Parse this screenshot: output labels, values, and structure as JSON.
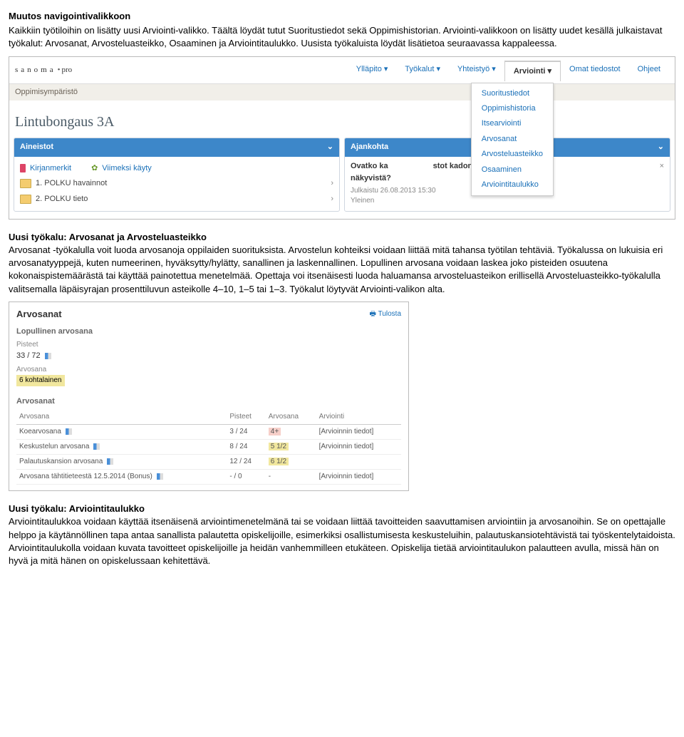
{
  "doc": {
    "h1": "Muutos navigointivalikkoon",
    "p1": "Kaikkiin työtiloihin on lisätty uusi Arviointi-valikko. Täältä löydät tutut Suoritustiedot sekä Oppimishistorian. Arviointi-valikkoon on lisätty uudet kesällä julkaistavat työkalut: Arvosanat, Arvosteluasteikko, Osaaminen ja Arviointitaulukko. Uusista työkaluista löydät lisätietoa seuraavassa kappaleessa.",
    "h2": "Uusi työkalu: Arvosanat ja Arvosteluasteikko",
    "p2": "Arvosanat -työkalulla voit luoda arvosanoja oppilaiden suorituksista. Arvostelun kohteiksi voidaan liittää mitä tahansa työtilan tehtäviä. Työkalussa on lukuisia eri arvosanatyyppejä, kuten numeerinen, hyväksytty/hylätty, sanallinen ja laskennallinen. Lopullinen arvosana voidaan laskea joko pisteiden osuutena kokonaispistemäärästä tai käyttää painotettua menetelmää. Opettaja voi itsenäisesti luoda haluamansa arvosteluasteikon erillisellä Arvosteluasteikko-työkalulla valitsemalla läpäisyrajan prosenttiluvun asteikolle 4–10, 1–5 tai 1–3. Työkalut löytyvät Arviointi-valikon alta.",
    "h3": "Uusi työkalu: Arviointitaulukko",
    "p3": "Arviointitaulukkoa voidaan käyttää itsenäisenä arviointimenetelmänä tai se voidaan liittää tavoitteiden saavuttamisen arviointiin ja arvosanoihin. Se on opettajalle helppo ja käytännöllinen tapa antaa sanallista palautetta opiskelijoille, esimerkiksi osallistumisesta keskusteluihin, palautuskansiotehtävistä tai työskentelytaidoista. Arviointitaulukolla voidaan kuvata tavoitteet opiskelijoille ja heidän vanhemmilleen etukäteen. Opiskelija tietää arviointitaulukon palautteen avulla, missä hän on hyvä ja mitä hänen on opiskelussaan kehitettävä."
  },
  "s1": {
    "logo1": "sanoma",
    "logo2": "pro",
    "subbrand": "Oppimisympäristö",
    "nav": {
      "yllapito": "Ylläpito",
      "tyokalut": "Työkalut",
      "yhteistyo": "Yhteistyö",
      "arviointi": "Arviointi",
      "omat": "Omat tiedostot",
      "ohjeet": "Ohjeet"
    },
    "dropdown": {
      "i1": "Suoritustiedot",
      "i2": "Oppimishistoria",
      "i3": "Itsearviointi",
      "i4": "Arvosanat",
      "i5": "Arvosteluasteikko",
      "i6": "Osaaminen",
      "i7": "Arviointitaulukko"
    },
    "course": "Lintubongaus 3A",
    "panelLeft": {
      "title": "Aineistot",
      "bookmarks": "Kirjanmerkit",
      "recent": "Viimeksi käyty",
      "item1": "1. POLKU havainnot",
      "item2": "2. POLKU tieto"
    },
    "panelRight": {
      "title": "Ajankohta",
      "msg1": "Ovatko ka",
      "msg2": "stot kadonneet",
      "msg3": "näkyvistä?",
      "meta": "Julkaistu 26.08.2013 15:30",
      "meta2": "Yleinen"
    }
  },
  "s2": {
    "title": "Arvosanat",
    "print": "Tulosta",
    "secFinal": "Lopullinen arvosana",
    "lblPoints": "Pisteet",
    "valPoints": "33 / 72",
    "lblGrade": "Arvosana",
    "valGrade": "6 kohtalainen",
    "secGrades": "Arvosanat",
    "table": {
      "h1": "Arvosana",
      "h2": "Pisteet",
      "h3": "Arvosana",
      "h4": "Arviointi",
      "r1c1": "Koearvosana",
      "r1c2": "3 / 24",
      "r1c3": "4+",
      "r1c4": "[Arvioinnin tiedot]",
      "r2c1": "Keskustelun arvosana",
      "r2c2": "8 / 24",
      "r2c3": "5 1/2",
      "r2c4": "[Arvioinnin tiedot]",
      "r3c1": "Palautuskansion arvosana",
      "r3c2": "12 / 24",
      "r3c3": "6 1/2",
      "r3c4": "",
      "r4c1": "Arvosana tähtitieteestä 12.5.2014 (Bonus)",
      "r4c2": "- / 0",
      "r4c3": "-",
      "r4c4": "[Arvioinnin tiedot]"
    }
  }
}
